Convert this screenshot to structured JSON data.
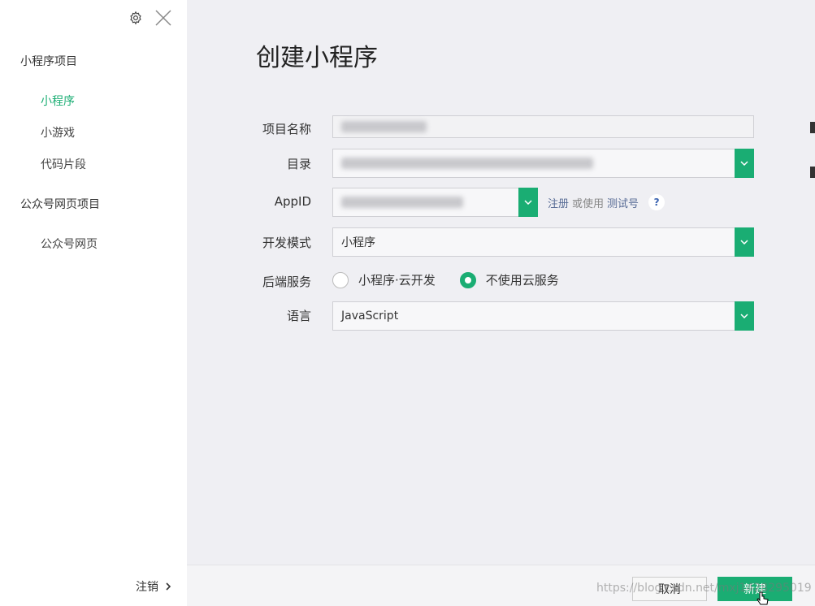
{
  "sidebar": {
    "section_miniprogram": "小程序项目",
    "items_miniprogram": [
      "小程序",
      "小游戏",
      "代码片段"
    ],
    "section_official": "公众号网页项目",
    "items_official": [
      "公众号网页"
    ],
    "logout": "注销"
  },
  "main": {
    "title": "创建小程序",
    "labels": {
      "project_name": "项目名称",
      "directory": "目录",
      "appid": "AppID",
      "dev_mode": "开发模式",
      "backend": "后端服务",
      "language": "语言"
    },
    "project_name_value": "",
    "directory_value": "",
    "appid_value": "",
    "appid_register": "注册",
    "appid_or_use": "或使用",
    "appid_test": "测试号",
    "help": "?",
    "dev_mode_value": "小程序",
    "backend_options": [
      "小程序·云开发",
      "不使用云服务"
    ],
    "backend_selected": "不使用云服务",
    "language_value": "JavaScript"
  },
  "footer": {
    "cancel": "取消",
    "create": "新建",
    "watermark": "https://blog.csdn.net/mxj1428295019"
  },
  "colors": {
    "accent": "#1aad73",
    "link": "#576b95"
  }
}
